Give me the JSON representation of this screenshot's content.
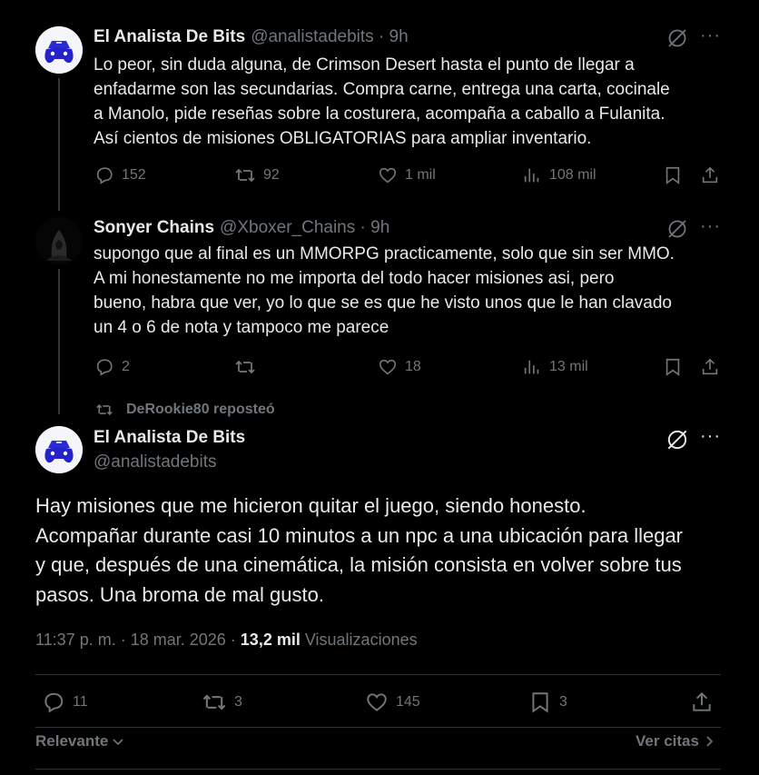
{
  "tweet1": {
    "name": "El Analista De Bits",
    "handle": "@analistadebits · 9h",
    "lines": [
      "Lo peor, sin duda alguna, de Crimson Desert hasta el punto de llegar a",
      "enfadarme son las secundarias. Compra carne, entrega una carta, cocinale",
      "a Manolo, pide reseñas sobre la costurera, acompaña a caballo a Fulanita.",
      "Así cientos de misiones OBLIGATORIAS para ampliar inventario."
    ],
    "replies": "152",
    "reposts": "92",
    "likes": "1 mil",
    "views": "108 mil"
  },
  "tweet2": {
    "name": "Sonyer Chains",
    "handle": "@Xboxer_Chains · 9h",
    "lines": [
      "supongo que al final es un MMORPG practicamente, solo que sin ser MMO.",
      "A mi honestamente no me importa del todo hacer misiones asi, pero",
      "bueno, habra que ver, yo lo que se es que he visto unos que le han clavado",
      "un 4 o 6 de nota y tampoco me parece"
    ],
    "replies": "2",
    "reposts": "",
    "likes": "18",
    "views": "13 mil"
  },
  "repost_note": "DeRookie80 reposteó",
  "main": {
    "name": "El Analista De Bits",
    "handle": "@analistadebits",
    "lines": [
      "Hay misiones que me hicieron quitar el juego, siendo honesto.",
      "Acompañar durante casi 10 minutos a un npc a una ubicación para llegar",
      "y que, después de una cinemática, la misión consista en volver sobre tus",
      "pasos. Una broma de mal gusto."
    ],
    "timestamp": "11:37 p. m. · 18 mar. 2026 · ",
    "views_count": "13,2 mil",
    "views_label": "Visualizaciones",
    "replies": "11",
    "reposts": "3",
    "likes": "145",
    "bookmarks": "3"
  },
  "footer": {
    "sort_label": "Relevante",
    "quotes_label": "Ver citas"
  },
  "icons": [
    "grok-icon",
    "more-icon",
    "reply-icon",
    "repost-icon",
    "like-icon",
    "views-icon",
    "bookmark-icon",
    "share-icon"
  ]
}
